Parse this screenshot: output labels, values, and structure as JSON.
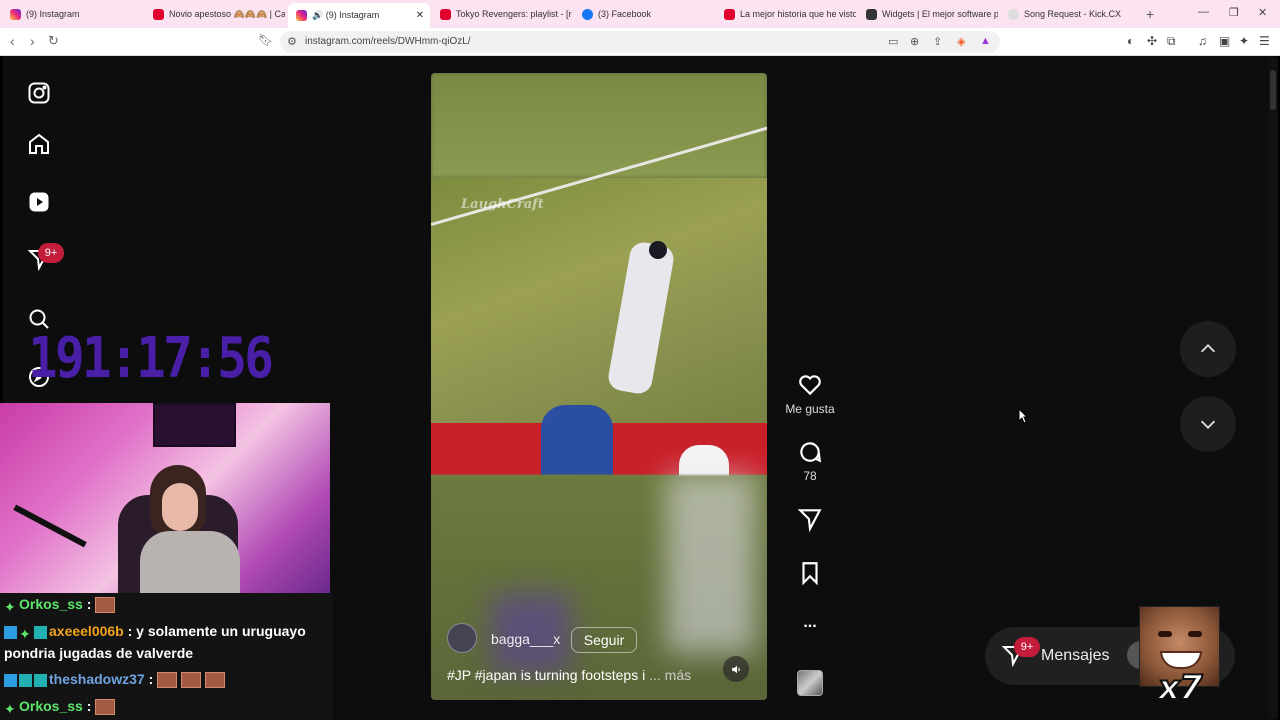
{
  "browser": {
    "tabs": [
      {
        "title": "(9) Instagram",
        "icon": "instagram-icon",
        "active": false
      },
      {
        "title": "Novio apestoso 🙈🙈🙈 | Cas",
        "icon": "youtube-icon",
        "active": false
      },
      {
        "title": "🔊 (9) Instagram",
        "icon": "instagram-icon",
        "active": true
      },
      {
        "title": "Tokyo Revengers: playlist - [rep",
        "icon": "youtube-icon",
        "active": false
      },
      {
        "title": "(3) Facebook",
        "icon": "facebook-icon",
        "active": false
      },
      {
        "title": "La mejor historia que he visto",
        "icon": "youtube-icon",
        "active": false
      },
      {
        "title": "Widgets | El mejor software pa",
        "icon": "widgets-icon",
        "active": false
      },
      {
        "title": "Song Request - Kick.CX",
        "icon": "globe-icon",
        "active": false
      }
    ],
    "new_tab": "+",
    "close_glyph": "✕",
    "url": "instagram.com/reels/DWHmm-qiOzL/",
    "brave_badge": "1"
  },
  "sidebar": {
    "items": [
      {
        "name": "instagram-logo-icon"
      },
      {
        "name": "home-icon"
      },
      {
        "name": "reels-icon"
      },
      {
        "name": "messages-icon",
        "badge": "9+"
      },
      {
        "name": "search-icon"
      },
      {
        "name": "explore-icon"
      }
    ]
  },
  "stream_overlay": {
    "timer": "191:17:56",
    "chat": [
      {
        "user": "Orkos_ss",
        "sep": " :",
        "message": "",
        "emotes": 1,
        "user_color": "green"
      },
      {
        "user": "axeeel006b",
        "sep": " :",
        "message": " y solamente un uruguayo",
        "continuation": "pondria jugadas de valverde",
        "emotes": 0,
        "user_color": "orange"
      },
      {
        "user": "theshadowz37",
        "sep": " :",
        "message": "",
        "emotes": 3,
        "user_color": "blue"
      },
      {
        "user": "Orkos_ss",
        "sep": " :",
        "message": "",
        "emotes": 1,
        "user_color": "green"
      }
    ],
    "meme_multiplier": "x7"
  },
  "reel": {
    "watermark": "LaughCraft",
    "username": "bagga___x",
    "follow_label": "Seguir",
    "caption_tags": "#JP #japan",
    "caption_text": " is turning footsteps i",
    "caption_more": "... más"
  },
  "actions": {
    "like_label": "Me gusta",
    "comment_count": "78",
    "more_glyph": "..."
  },
  "messages_bubble": {
    "label": "Mensajes",
    "badge": "9+"
  },
  "colors": {
    "timer": "#4a1fa8",
    "badge_red": "#c31d3b",
    "tab_bar": "#fbe3f1"
  }
}
